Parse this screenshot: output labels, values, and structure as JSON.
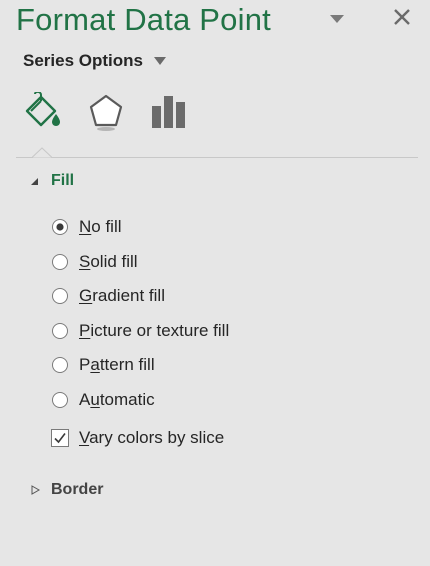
{
  "pane": {
    "title": "Format Data Point",
    "options_icon": "chevron-down-icon",
    "close_icon": "close-icon"
  },
  "series_options": {
    "label": "Series Options"
  },
  "tabs": [
    {
      "name": "fill-line",
      "icon": "paint-bucket-icon",
      "selected": true
    },
    {
      "name": "effects",
      "icon": "pentagon-icon",
      "selected": false
    },
    {
      "name": "series-options",
      "icon": "bar-chart-icon",
      "selected": false
    }
  ],
  "fill_section": {
    "label": "Fill",
    "expanded": true,
    "options": [
      {
        "key": "N",
        "rest": "o fill",
        "selected": true
      },
      {
        "key": "S",
        "rest": "olid fill",
        "selected": false
      },
      {
        "key": "G",
        "rest": "radient fill",
        "selected": false
      },
      {
        "key": "P",
        "rest": "icture or texture fill",
        "selected": false
      },
      {
        "pre": "P",
        "key": "a",
        "rest": "ttern fill",
        "selected": false
      },
      {
        "pre": "A",
        "key": "u",
        "rest": "tomatic",
        "selected": false
      }
    ],
    "vary_colors": {
      "key": "V",
      "rest": "ary colors by slice",
      "checked": true
    }
  },
  "border_section": {
    "label": "Border",
    "expanded": false
  },
  "colors": {
    "accent": "#217346",
    "background": "#e6e6e6",
    "text": "#262626"
  }
}
